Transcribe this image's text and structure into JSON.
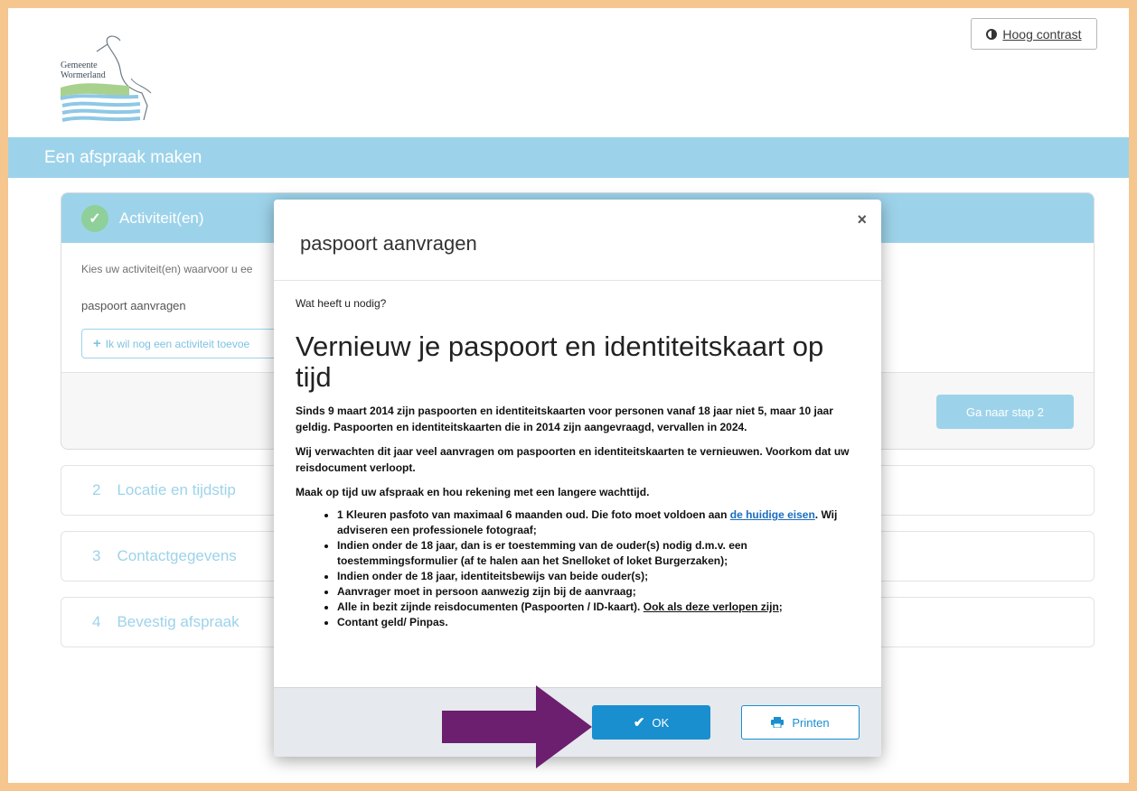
{
  "header": {
    "logo_text": [
      "Gemeente",
      "Wormerland"
    ],
    "contrast_label": "Hoog contrast",
    "page_title": "Een afspraak maken"
  },
  "step1": {
    "title": "Activiteit(en)",
    "hint": "Kies uw activiteit(en) waarvoor u ee",
    "activity": "paspoort aanvragen",
    "add_button": "Ik wil nog een activiteit toevoe",
    "next_button": "Ga naar stap 2"
  },
  "steps": [
    {
      "num": "2",
      "label": "Locatie en tijdstip"
    },
    {
      "num": "3",
      "label": "Contactgegevens"
    },
    {
      "num": "4",
      "label": "Bevestig afspraak"
    }
  ],
  "modal": {
    "title": "paspoort aanvragen",
    "close": "×",
    "question": "Wat heeft u nodig?",
    "heading": "Vernieuw je paspoort en identiteitskaart op tijd",
    "paragraphs": [
      "Sinds 9 maart 2014 zijn paspoorten en identiteitskaarten voor personen vanaf 18 jaar niet 5, maar 10 jaar geldig. Paspoorten en identiteitskaarten die in 2014 zijn aangevraagd, vervallen in 2024.",
      "Wij verwachten dit jaar veel aanvragen om paspoorten en identiteitskaarten te vernieuwen. Voorkom dat uw reisdocument verloopt.",
      "Maak op tijd uw afspraak en hou rekening met een langere wachttijd."
    ],
    "list": {
      "item1_a": "1 Kleuren pasfoto van maximaal 6 maanden oud. Die foto moet voldoen aan ",
      "item1_link": "de huidige eisen",
      "item1_b": ". Wij adviseren een professionele fotograaf;",
      "item2": "Indien onder de 18 jaar, dan is er toestemming van de ouder(s) nodig d.m.v. een toestemmingsformulier (af te halen aan het Snelloket of loket Burgerzaken);",
      "item3": "Indien onder de 18 jaar, identiteitsbewijs van beide ouder(s);",
      "item4": "Aanvrager moet in persoon aanwezig zijn bij de aanvraag;",
      "item5_a": "Alle in bezit zijnde reisdocumenten (Paspoorten / ID-kaart). ",
      "item5_u": "Ook als deze verlopen zijn",
      "item5_b": ";",
      "item6": "Contant geld/ Pinpas."
    },
    "ok_label": "OK",
    "print_label": "Printen"
  },
  "colors": {
    "border": "#f6c68f",
    "accent_light": "#9dd3ea",
    "primary": "#1a8fd0",
    "arrow": "#6b1f6e",
    "check_green": "#8fcf9a"
  }
}
